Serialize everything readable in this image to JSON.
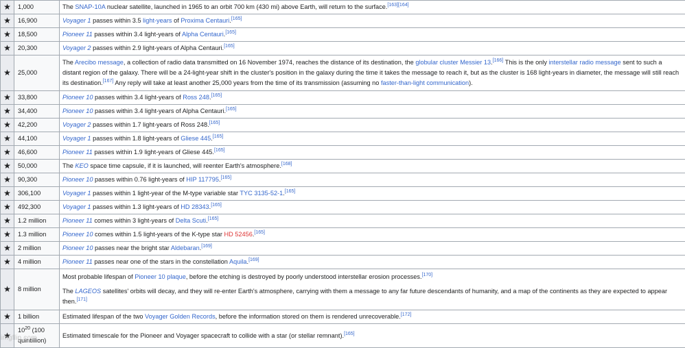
{
  "watermark": "imgflip.com",
  "star_glyph": "★",
  "rows": [
    {
      "year": "1,000",
      "paras": [
        [
          {
            "t": "The "
          },
          {
            "t": "SNAP-10A",
            "c": "lk"
          },
          {
            "t": " nuclear satellite, launched in 1965 to an orbit 700 km (430 mi) above Earth, will return to the surface."
          },
          {
            "t": "[163][164]",
            "c": "ref"
          }
        ]
      ]
    },
    {
      "year": "16,900",
      "paras": [
        [
          {
            "t": "Voyager 1",
            "c": "lk it"
          },
          {
            "t": " passes within 3.5 "
          },
          {
            "t": "light-years",
            "c": "lk"
          },
          {
            "t": " of "
          },
          {
            "t": "Proxima Centauri",
            "c": "lk"
          },
          {
            "t": "."
          },
          {
            "t": "[165]",
            "c": "ref"
          }
        ]
      ]
    },
    {
      "year": "18,500",
      "paras": [
        [
          {
            "t": "Pioneer 11",
            "c": "lk it"
          },
          {
            "t": " passes within 3.4 light-years of "
          },
          {
            "t": "Alpha Centauri",
            "c": "lk"
          },
          {
            "t": "."
          },
          {
            "t": "[165]",
            "c": "ref"
          }
        ]
      ]
    },
    {
      "year": "20,300",
      "paras": [
        [
          {
            "t": "Voyager 2",
            "c": "lk it"
          },
          {
            "t": " passes within 2.9 light-years of Alpha Centauri."
          },
          {
            "t": "[165]",
            "c": "ref"
          }
        ]
      ]
    },
    {
      "year": "25,000",
      "cls": "r-arecibo",
      "paras": [
        [
          {
            "t": "The "
          },
          {
            "t": "Arecibo message",
            "c": "lk"
          },
          {
            "t": ", a collection of radio data transmitted on 16 November 1974, reaches the distance of its destination, the "
          },
          {
            "t": "globular cluster",
            "c": "lk"
          },
          {
            "t": " "
          },
          {
            "t": "Messier 13",
            "c": "lk"
          },
          {
            "t": "."
          },
          {
            "t": "[166]",
            "c": "ref"
          },
          {
            "t": " This is the only "
          },
          {
            "t": "interstellar radio message",
            "c": "lk"
          },
          {
            "t": " sent to such a distant region of the galaxy. There will be a 24-light-year shift in the cluster's position in the galaxy during the time it takes the message to reach it, but as the cluster is 168 light-years in diameter, the message will still reach its destination."
          },
          {
            "t": "[167]",
            "c": "ref"
          },
          {
            "t": " Any reply will take at least another 25,000 years from the time of its transmission (assuming no "
          },
          {
            "t": "faster-than-light communication",
            "c": "lk"
          },
          {
            "t": ")."
          }
        ]
      ]
    },
    {
      "year": "33,800",
      "paras": [
        [
          {
            "t": "Pioneer 10",
            "c": "lk it"
          },
          {
            "t": " passes within 3.4 light-years of "
          },
          {
            "t": "Ross 248",
            "c": "lk"
          },
          {
            "t": "."
          },
          {
            "t": "[165]",
            "c": "ref"
          }
        ]
      ]
    },
    {
      "year": "34,400",
      "paras": [
        [
          {
            "t": "Pioneer 10",
            "c": "lk it"
          },
          {
            "t": " passes within 3.4 light-years of Alpha Centauri."
          },
          {
            "t": "[165]",
            "c": "ref"
          }
        ]
      ]
    },
    {
      "year": "42,200",
      "paras": [
        [
          {
            "t": "Voyager 2",
            "c": "lk it"
          },
          {
            "t": " passes within 1.7 light-years of Ross 248."
          },
          {
            "t": "[165]",
            "c": "ref"
          }
        ]
      ]
    },
    {
      "year": "44,100",
      "paras": [
        [
          {
            "t": "Voyager 1",
            "c": "lk it"
          },
          {
            "t": " passes within 1.8 light-years of "
          },
          {
            "t": "Gliese 445",
            "c": "lk"
          },
          {
            "t": "."
          },
          {
            "t": "[165]",
            "c": "ref"
          }
        ]
      ]
    },
    {
      "year": "46,600",
      "paras": [
        [
          {
            "t": "Pioneer 11",
            "c": "lk it"
          },
          {
            "t": " passes within 1.9 light-years of Gliese 445."
          },
          {
            "t": "[165]",
            "c": "ref"
          }
        ]
      ]
    },
    {
      "year": "50,000",
      "paras": [
        [
          {
            "t": "The "
          },
          {
            "t": "KEO",
            "c": "lk it"
          },
          {
            "t": " space time capsule, if it is launched, will reenter Earth's atmosphere."
          },
          {
            "t": "[168]",
            "c": "ref"
          }
        ]
      ]
    },
    {
      "year": "90,300",
      "paras": [
        [
          {
            "t": "Pioneer 10",
            "c": "lk it"
          },
          {
            "t": " passes within 0.76 light-years of "
          },
          {
            "t": "HIP 117795",
            "c": "lk"
          },
          {
            "t": "."
          },
          {
            "t": "[165]",
            "c": "ref"
          }
        ]
      ]
    },
    {
      "year": "306,100",
      "paras": [
        [
          {
            "t": "Voyager 1",
            "c": "lk it"
          },
          {
            "t": " passes within 1 light-year of the M-type variable star "
          },
          {
            "t": "TYC 3135-52-1",
            "c": "lk"
          },
          {
            "t": "."
          },
          {
            "t": "[165]",
            "c": "ref"
          }
        ]
      ]
    },
    {
      "year": "492,300",
      "paras": [
        [
          {
            "t": "Voyager 1",
            "c": "lk it"
          },
          {
            "t": " passes within 1.3 light-years of "
          },
          {
            "t": "HD 28343",
            "c": "lk"
          },
          {
            "t": "."
          },
          {
            "t": "[165]",
            "c": "ref"
          }
        ]
      ]
    },
    {
      "year": "1.2 million",
      "paras": [
        [
          {
            "t": "Pioneer 11",
            "c": "lk it"
          },
          {
            "t": " comes within 3 light-years of "
          },
          {
            "t": "Delta Scuti",
            "c": "lk"
          },
          {
            "t": "."
          },
          {
            "t": "[165]",
            "c": "ref"
          }
        ]
      ]
    },
    {
      "year": "1.3 million",
      "paras": [
        [
          {
            "t": "Pioneer 10",
            "c": "lk it"
          },
          {
            "t": " comes within 1.5 light-years of the K-type star "
          },
          {
            "t": "HD 52456",
            "c": "nw"
          },
          {
            "t": "."
          },
          {
            "t": "[165]",
            "c": "ref"
          }
        ]
      ]
    },
    {
      "year": "2 million",
      "paras": [
        [
          {
            "t": "Pioneer 10",
            "c": "lk it"
          },
          {
            "t": " passes near the bright star "
          },
          {
            "t": "Aldebaran",
            "c": "lk"
          },
          {
            "t": "."
          },
          {
            "t": "[169]",
            "c": "ref"
          }
        ]
      ]
    },
    {
      "year": "4 million",
      "paras": [
        [
          {
            "t": "Pioneer 11",
            "c": "lk it"
          },
          {
            "t": " passes near one of the stars in the constellation "
          },
          {
            "t": "Aquila",
            "c": "lk"
          },
          {
            "t": "."
          },
          {
            "t": "[169]",
            "c": "ref"
          }
        ]
      ]
    },
    {
      "year": "8 million",
      "cls": "r-8m",
      "paras": [
        [
          {
            "t": "Most probable lifespan of "
          },
          {
            "t": "Pioneer 10 plaque",
            "c": "lk"
          },
          {
            "t": ", before the etching is destroyed by poorly understood interstellar erosion processes."
          },
          {
            "t": "[170]",
            "c": "ref"
          }
        ],
        [
          {
            "t": "The "
          },
          {
            "t": "LAGEOS",
            "c": "lk it"
          },
          {
            "t": " satellites' orbits will decay, and they will re-enter Earth's atmosphere, carrying with them a message to any far future descendants of humanity, and a map of the continents as they are expected to appear then."
          },
          {
            "t": "[171]",
            "c": "ref"
          }
        ]
      ]
    },
    {
      "year": "1 billion",
      "paras": [
        [
          {
            "t": "Estimated lifespan of the two "
          },
          {
            "t": "Voyager Golden Records",
            "c": "lk"
          },
          {
            "t": ", before the information stored on them is rendered unrecoverable."
          },
          {
            "t": "[172]",
            "c": "ref"
          }
        ]
      ]
    },
    {
      "year_parts": [
        {
          "t": "10"
        },
        {
          "t": "20",
          "c": "exp"
        },
        {
          "t": " (100 quintillion)"
        }
      ],
      "paras": [
        [
          {
            "t": "Estimated timescale for the Pioneer and Voyager spacecraft to collide with a star (or stellar remnant)."
          },
          {
            "t": "[165]",
            "c": "ref"
          }
        ]
      ]
    }
  ]
}
